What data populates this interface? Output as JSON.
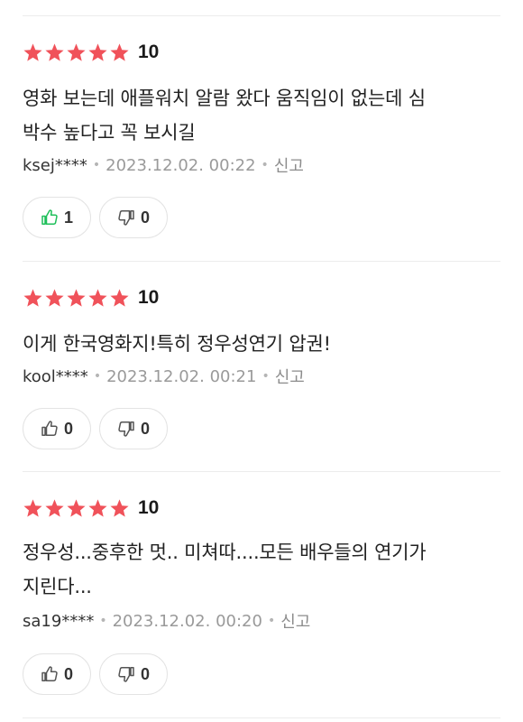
{
  "reviews": [
    {
      "rating": 5,
      "score": "10",
      "text_lines": [
        "영화 보는데 애플워치 알람 왔다 움직임이 없는데 심",
        "박수 높다고 꼭 보시길"
      ],
      "user": "ksej****",
      "date": "2023.12.02. 00:22",
      "report_label": "신고",
      "like_count": "1",
      "dislike_count": "0",
      "liked": true
    },
    {
      "rating": 5,
      "score": "10",
      "text_lines": [
        "이게 한국영화지!특히 정우성연기 압권!"
      ],
      "user": "kool****",
      "date": "2023.12.02. 00:21",
      "report_label": "신고",
      "like_count": "0",
      "dislike_count": "0",
      "liked": false
    },
    {
      "rating": 5,
      "score": "10",
      "text_lines": [
        "정우성...중후한 멋.. 미쳐따....모든 배우들의 연기가",
        "지린다..."
      ],
      "user": "sa19****",
      "date": "2023.12.02. 00:20",
      "report_label": "신고",
      "like_count": "0",
      "dislike_count": "0",
      "liked": false
    }
  ],
  "colors": {
    "star": "#f0525a",
    "liked_thumb": "#1fbf5a",
    "thumb": "#555555"
  }
}
